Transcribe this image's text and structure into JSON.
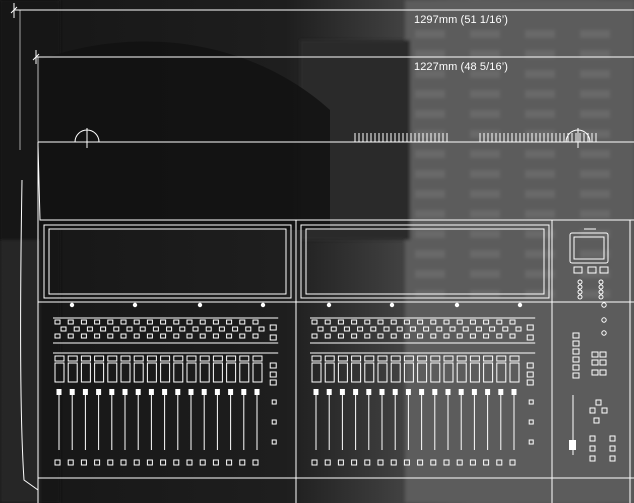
{
  "dimensions": {
    "overall_width_label": "1297mm (51 1/16’)",
    "frame_width_label": "1227mm (48 5/16’)"
  },
  "console": {
    "fader_banks": [
      {
        "name": "left",
        "faders": 16
      },
      {
        "name": "right",
        "faders": 16
      }
    ],
    "screens": 2
  },
  "colors": {
    "line": "#ffffff",
    "background_dark": "#1c1c1c",
    "background_photo": "#5a5a5a"
  }
}
